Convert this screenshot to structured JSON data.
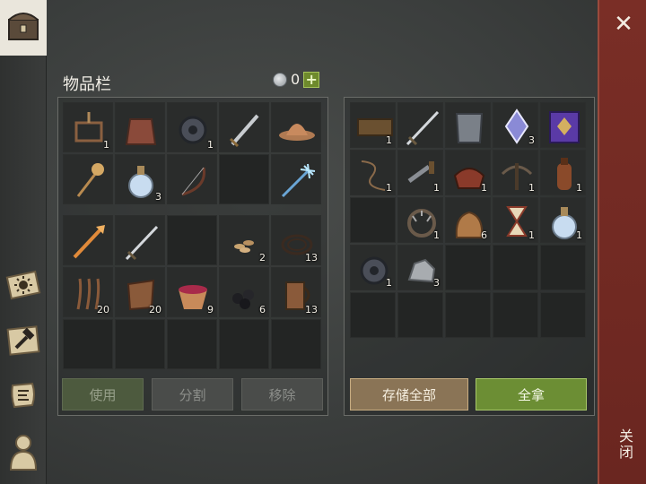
{
  "inventory": {
    "title": "物品栏",
    "currency": {
      "value": "0",
      "add_label": "+"
    },
    "buttons": {
      "use": "使用",
      "split": "分割",
      "remove": "移除"
    },
    "equip_slots": [
      {
        "icon": "trap-icon",
        "qty": "1"
      },
      {
        "icon": "chainmail-icon",
        "qty": ""
      },
      {
        "icon": "gear-icon",
        "qty": "1"
      },
      {
        "icon": "sword-icon",
        "qty": ""
      },
      {
        "icon": "leather-hat-icon",
        "qty": ""
      },
      {
        "icon": "mace-icon",
        "qty": ""
      },
      {
        "icon": "potion-icon",
        "qty": "3"
      },
      {
        "icon": "bow-icon",
        "qty": ""
      },
      {
        "icon": "empty",
        "qty": ""
      },
      {
        "icon": "ice-spear-icon",
        "qty": ""
      }
    ],
    "bag_slots": [
      {
        "icon": "fire-spear-icon",
        "qty": ""
      },
      {
        "icon": "longsword-icon",
        "qty": ""
      },
      {
        "icon": "empty",
        "qty": ""
      },
      {
        "icon": "seeds-icon",
        "qty": "2"
      },
      {
        "icon": "rope-icon",
        "qty": "13"
      },
      {
        "icon": "fiber-icon",
        "qty": "20"
      },
      {
        "icon": "leather-icon",
        "qty": "20"
      },
      {
        "icon": "berry-bowl-icon",
        "qty": "9"
      },
      {
        "icon": "coal-icon",
        "qty": "6"
      },
      {
        "icon": "mug-icon",
        "qty": "13"
      }
    ]
  },
  "storage": {
    "buttons": {
      "store_all": "存储全部",
      "take_all": "全拿"
    },
    "slots": [
      {
        "icon": "plank-icon",
        "qty": "1"
      },
      {
        "icon": "longsword-icon",
        "qty": ""
      },
      {
        "icon": "armor-icon",
        "qty": ""
      },
      {
        "icon": "crystal-icon",
        "qty": "3"
      },
      {
        "icon": "spellbook-icon",
        "qty": ""
      },
      {
        "icon": "whip-icon",
        "qty": "1"
      },
      {
        "icon": "crank-icon",
        "qty": "1"
      },
      {
        "icon": "saddle-icon",
        "qty": "1"
      },
      {
        "icon": "crossbow-icon",
        "qty": "1"
      },
      {
        "icon": "bottle-icon",
        "qty": "1"
      },
      {
        "icon": "empty",
        "qty": ""
      },
      {
        "icon": "bear-trap-icon",
        "qty": "1"
      },
      {
        "icon": "grain-sack-icon",
        "qty": "6"
      },
      {
        "icon": "hourglass-icon",
        "qty": "1"
      },
      {
        "icon": "potion-icon",
        "qty": "1"
      },
      {
        "icon": "gear-icon",
        "qty": "1"
      },
      {
        "icon": "ore-icon",
        "qty": "3"
      }
    ]
  },
  "close_label": "关闭",
  "sidebar_tabs": [
    "chest-icon",
    "sun-map-icon",
    "crafting-hammer-icon",
    "quest-scroll-icon",
    "character-icon"
  ],
  "colors": {
    "close_panel": "#7a2e26",
    "take_all": "#6c8e34",
    "store_all": "#8a7456",
    "plus": "#6e8a2c"
  }
}
